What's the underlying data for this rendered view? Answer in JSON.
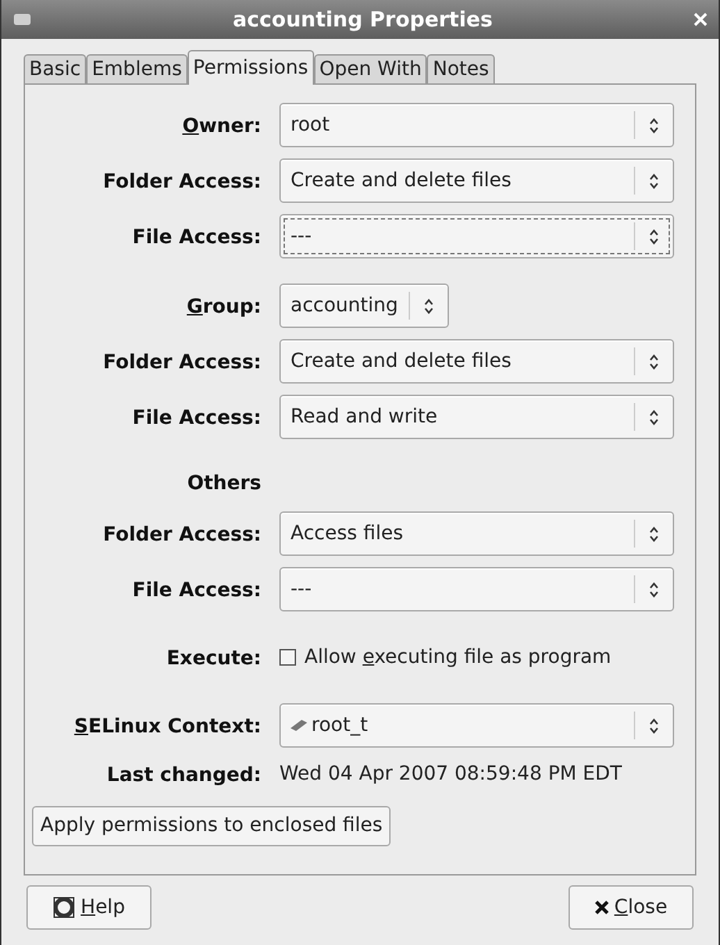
{
  "window": {
    "title": "accounting Properties"
  },
  "tabs": [
    {
      "label": "Basic",
      "selected": false
    },
    {
      "label": "Emblems",
      "selected": false
    },
    {
      "label": "Permissions",
      "selected": true
    },
    {
      "label": "Open With",
      "selected": false
    },
    {
      "label": "Notes",
      "selected": false
    }
  ],
  "sections": [
    {
      "rows": [
        {
          "kind": "combo",
          "label": {
            "key": "O",
            "post": "wner:"
          },
          "value": "root",
          "focused": false
        },
        {
          "kind": "combo",
          "label": {
            "pre": "Folder Access:"
          },
          "value": "Create and delete files",
          "focused": false
        },
        {
          "kind": "combo",
          "label": {
            "pre": "File Access:"
          },
          "value": "---",
          "focused": true
        }
      ]
    },
    {
      "rows": [
        {
          "kind": "small_combo",
          "label": {
            "key": "G",
            "post": "roup:"
          },
          "value": "accounting",
          "focused": false
        },
        {
          "kind": "combo",
          "label": {
            "pre": "Folder Access:"
          },
          "value": "Create and delete files",
          "focused": false
        },
        {
          "kind": "combo",
          "label": {
            "pre": "File Access:"
          },
          "value": "Read and write",
          "focused": false
        }
      ]
    },
    {
      "rows": [
        {
          "kind": "heading",
          "label": {
            "pre": "Others"
          }
        },
        {
          "kind": "combo",
          "label": {
            "pre": "Folder Access:"
          },
          "value": "Access files",
          "focused": false
        },
        {
          "kind": "combo",
          "label": {
            "pre": "File Access:"
          },
          "value": "---",
          "focused": false
        }
      ]
    },
    {
      "rows": [
        {
          "kind": "checkbox",
          "label": {
            "pre": "Execute:"
          },
          "text": {
            "pre": "Allow ",
            "key": "e",
            "post": "xecuting file as program"
          },
          "checked": false
        }
      ]
    },
    {
      "rows": [
        {
          "kind": "context_combo",
          "label": {
            "key": "S",
            "post": "ELinux Context:"
          },
          "value": "root_t",
          "focused": false
        },
        {
          "kind": "text",
          "label": {
            "pre": "Last changed:"
          },
          "value": "Wed 04 Apr 2007 08:59:48 PM EDT"
        },
        {
          "kind": "button",
          "text": "Apply permissions to enclosed files"
        }
      ]
    }
  ],
  "buttons": [
    {
      "kind": "help",
      "label": {
        "key": "H",
        "post": "elp"
      }
    },
    {
      "kind": "close",
      "label": {
        "key": "C",
        "post": "lose"
      }
    }
  ]
}
